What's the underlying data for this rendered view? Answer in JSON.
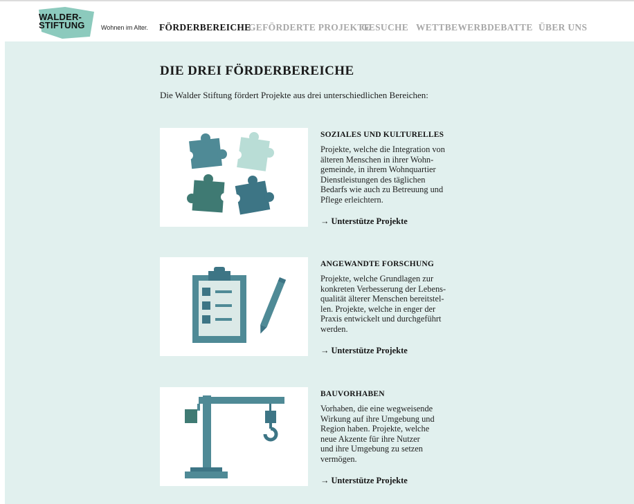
{
  "header": {
    "logo": {
      "line1": "WALDER-",
      "line2": "STIFTUNG"
    },
    "tagline": "Wohnen im Alter.",
    "nav": [
      {
        "label": "FÖRDERBEREICHE",
        "active": true
      },
      {
        "label": "GEFÖRDERTE PROJEKTE",
        "active": false
      },
      {
        "label": "GESUCHE",
        "active": false
      },
      {
        "label": "WETTBEWERB",
        "active": false
      },
      {
        "label": "DEBATTE",
        "active": false
      },
      {
        "label": "ÜBER UNS",
        "active": false
      }
    ]
  },
  "colors": {
    "background": "#e1f0ee",
    "logo_shape": "#8ccabd",
    "icon_teal": "#4f8a96",
    "icon_light": "#b9ddd6",
    "nav_inactive": "#a8a8a8"
  },
  "main": {
    "title": "DIE DREI FÖRDERBEREICHE",
    "intro": "Die Walder Stiftung fördert Projekte aus drei unterschiedlichen Bereichen:",
    "sections": [
      {
        "icon": "puzzle-pieces-icon",
        "heading": "SOZIALES UND KULTURELLES",
        "lines": [
          "Projekte, welche die Integration von",
          "älteren Menschen in ihrer Wohn-",
          "gemeinde, in ihrem Wohnquartier",
          "Dienstleistungen des täglichen",
          "Bedarfs wie auch zu Betreuung und",
          "Pflege erleichtern."
        ],
        "link": "→ Unterstütze Projekte"
      },
      {
        "icon": "clipboard-checklist-icon",
        "heading": "ANGEWANDTE FORSCHUNG",
        "lines": [
          "Projekte, welche Grundlagen zur",
          "konkreten Verbesserung der Lebens-",
          "qualität älterer Menschen bereitstel-",
          "len. Projekte, welche in enger der",
          "Praxis entwickelt und durchgeführt",
          "werden."
        ],
        "link": "→ Unterstütze Projekte"
      },
      {
        "icon": "crane-icon",
        "heading": "BAUVORHABEN",
        "lines": [
          "Vorhaben, die eine wegweisende",
          "Wirkung auf ihre Umgebung und",
          "Region haben. Projekte, welche",
          "neue Akzente für ihre Nutzer",
          "und ihre Umgebung zu setzen",
          "vermögen."
        ],
        "link": "→ Unterstütze Projekte"
      }
    ]
  }
}
